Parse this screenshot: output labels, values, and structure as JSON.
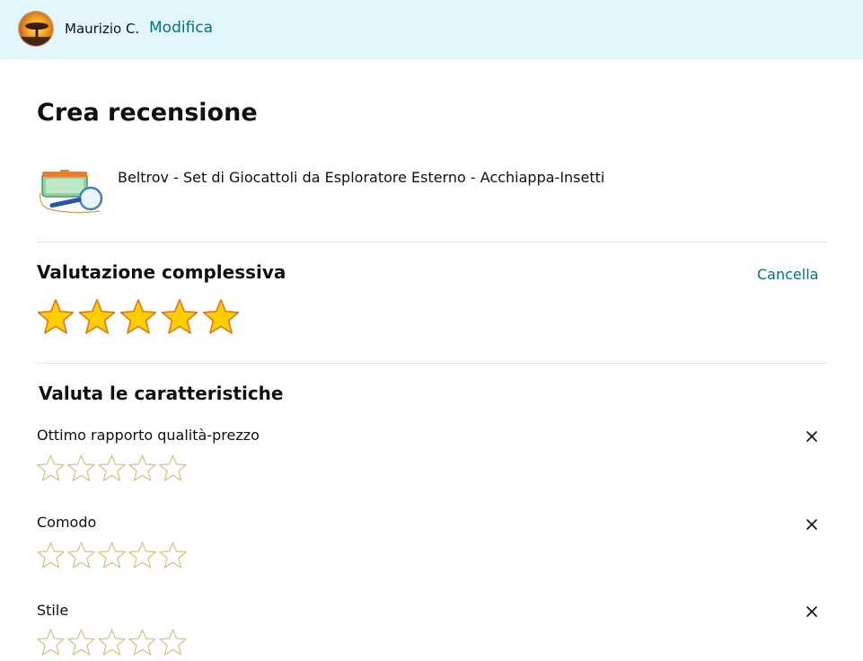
{
  "header": {
    "user_name": "Maurizio C.",
    "edit_label": "Modifica",
    "avatar_icon": "sunset-tree-avatar"
  },
  "page": {
    "title": "Crea recensione"
  },
  "product": {
    "title": "Beltrov - Set di Giocattoli da Esploratore Esterno - Acchiappa-Insetti",
    "thumbnail_icon": "bug-catcher-kit-thumbnail"
  },
  "overall": {
    "title": "Valutazione complessiva",
    "clear_label": "Cancella",
    "rating": 5,
    "max_rating": 5
  },
  "features": {
    "title": "Valuta le caratteristiche",
    "items": [
      {
        "label": "Ottimo rapporto qualità-prezzo",
        "rating": 0,
        "max_rating": 5
      },
      {
        "label": "Comodo",
        "rating": 0,
        "max_rating": 5
      },
      {
        "label": "Stile",
        "rating": 0,
        "max_rating": 5
      }
    ]
  },
  "colors": {
    "header_bg": "#e3f6fb",
    "link": "#007185",
    "star_fill": "#ffce00",
    "star_outline": "#de7921",
    "empty_star_outline": "#d6c083"
  }
}
